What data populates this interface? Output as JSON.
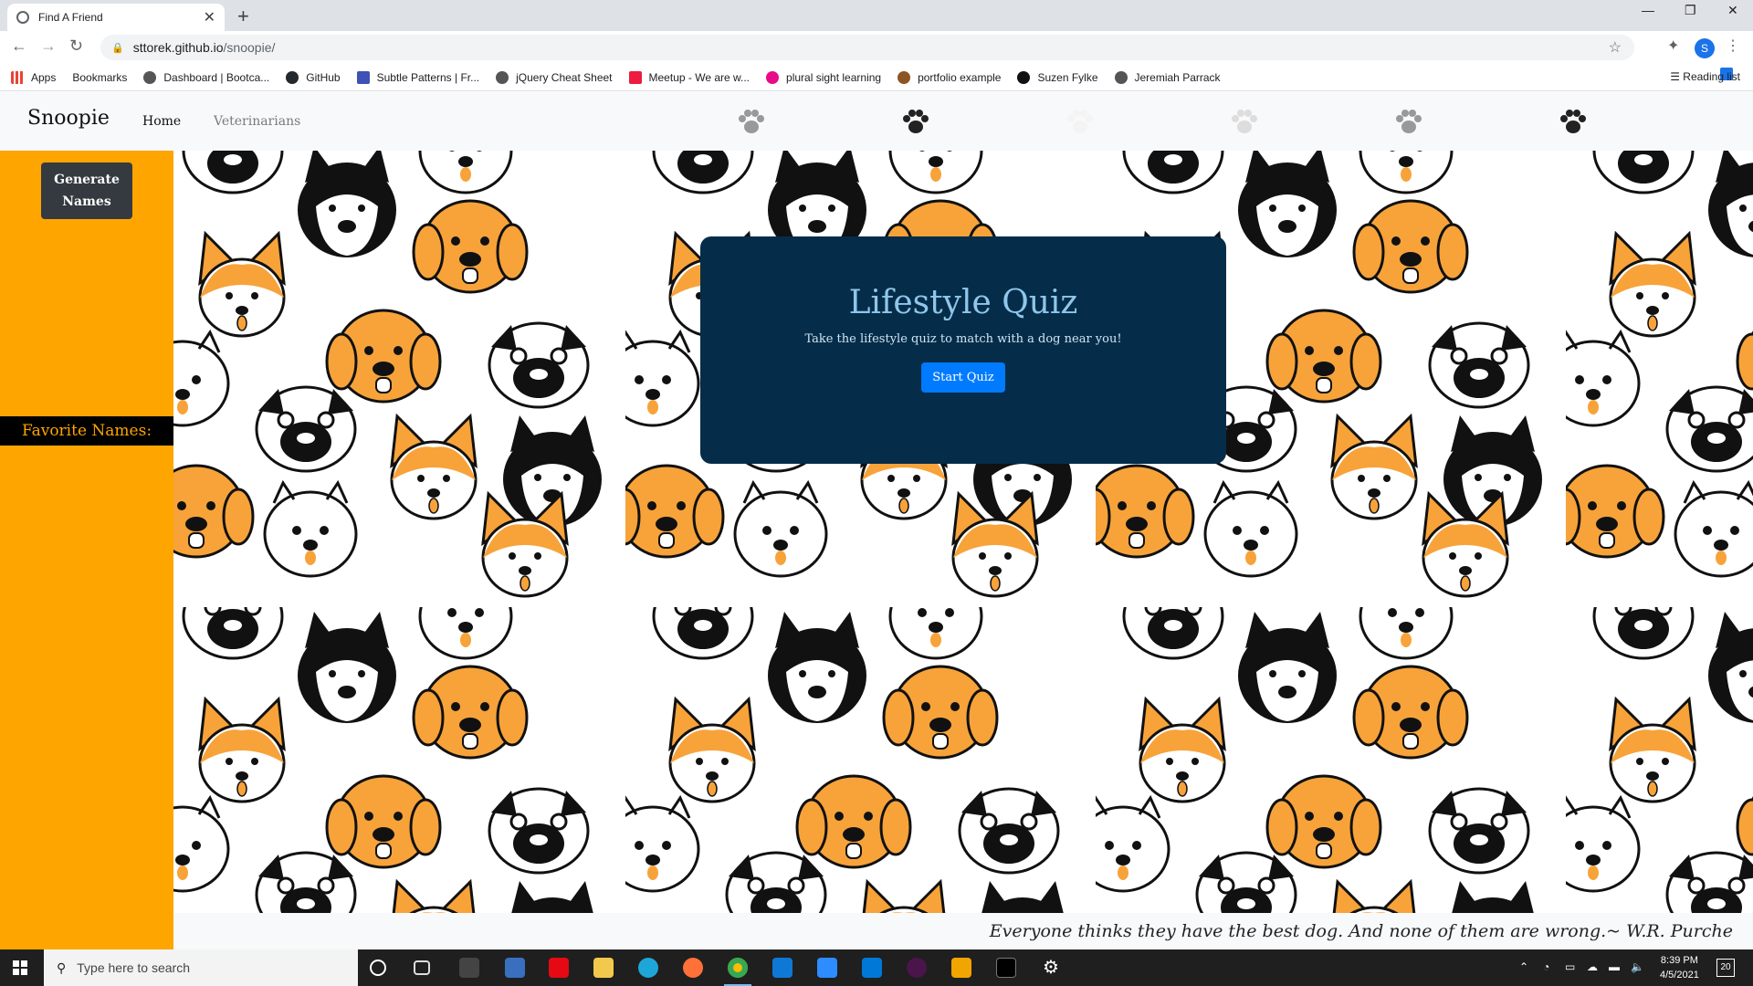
{
  "browser": {
    "tab_title": "Find A Friend",
    "url_host": "sttorek.github.io",
    "url_path": "/snoopie/",
    "bookmarks": [
      "Apps",
      "Bookmarks",
      "Dashboard | Bootca...",
      "GitHub",
      "Subtle Patterns | Fr...",
      "jQuery Cheat Sheet",
      "Meetup - We are w...",
      "plural sight learning",
      "portfolio example",
      "Suzen Fylke",
      "Jeremiah Parrack"
    ],
    "reading_list": "Reading list",
    "profile_initial": "S"
  },
  "navbar": {
    "brand": "Snoopie",
    "links": [
      "Home",
      "Veterinarians"
    ]
  },
  "sidebar": {
    "generate_label": "Generate Names",
    "favorites_label": "Favorite Names:"
  },
  "quiz": {
    "title": "Lifestyle Quiz",
    "subtitle": "Take the lifestyle quiz to match with a dog near you!",
    "button": "Start Quiz"
  },
  "quote": "Everyone thinks they have the best dog. And none of them are wrong.~ W.R. Purche",
  "taskbar": {
    "search_placeholder": "Type here to search",
    "time": "8:39 PM",
    "date": "4/5/2021",
    "notifications": "20"
  },
  "colors": {
    "sidebar": "#ffa500",
    "quiz_panel": "#052c49",
    "quiz_title": "#8fc6ea",
    "button_primary": "#007bff",
    "dog_orange": "#f7a33a"
  }
}
